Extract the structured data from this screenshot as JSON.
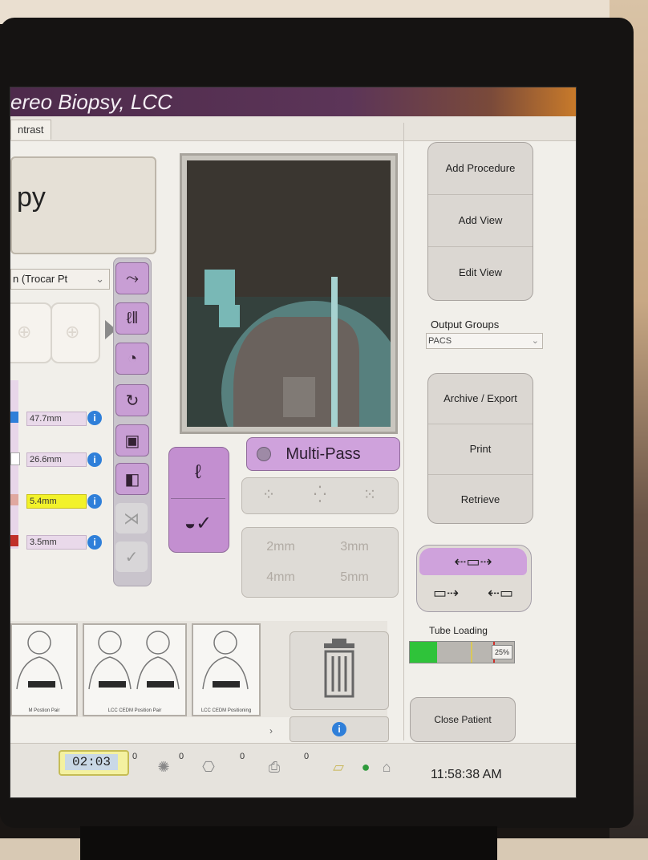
{
  "window": {
    "title": "ereo Biopsy, LCC"
  },
  "tabs": [
    {
      "label": "ntrast"
    }
  ],
  "left": {
    "big_label": "py",
    "needle_select": "n (Trocar Pt",
    "measurements": [
      {
        "value": "47.7mm",
        "highlight": false,
        "bar_color": "#2f7fd9"
      },
      {
        "value": "26.6mm",
        "highlight": false,
        "bar_color": "#ffffff"
      },
      {
        "value": "5.4mm",
        "highlight": true,
        "bar_color": "#e0a8a0"
      },
      {
        "value": "3.5mm",
        "highlight": false,
        "bar_color": "#c0302a"
      }
    ]
  },
  "tools": [
    {
      "name": "needle-path-icon",
      "glyph": "⤳",
      "active": true
    },
    {
      "name": "needle-depth-icon",
      "glyph": "ℓ‖",
      "active": true
    },
    {
      "name": "breast-icon",
      "glyph": "◔",
      "active": true
    },
    {
      "name": "rotate-icon",
      "glyph": "↻",
      "active": true
    },
    {
      "name": "monitor-icon",
      "glyph": "▣",
      "active": true
    },
    {
      "name": "contrast-icon",
      "glyph": "◧",
      "active": true
    },
    {
      "name": "split-icon",
      "glyph": "⋊",
      "active": false
    },
    {
      "name": "check-icon",
      "glyph": "✓",
      "active": false
    }
  ],
  "modes": [
    {
      "name": "mode-outline",
      "glyph": "ℓ"
    },
    {
      "name": "mode-filled-check",
      "glyph": "◒✓"
    }
  ],
  "multipass": {
    "label": "Multi-Pass"
  },
  "patterns": [
    "⁘",
    "⁛",
    "⁙"
  ],
  "sizes": [
    "2mm",
    "3mm",
    "4mm",
    "5mm"
  ],
  "right": {
    "group1": [
      "Add Procedure",
      "Add View",
      "Edit View"
    ],
    "output_groups_label": "Output Groups",
    "output_groups_value": "PACS",
    "group2": [
      "Archive / Export",
      "Print",
      "Retrieve"
    ],
    "tube_loading_label": "Tube Loading",
    "tube_loading_fraction": 0.26,
    "tube_pct": "25%",
    "close_patient": "Close Patient"
  },
  "thumbnails": [
    {
      "caption": "M Postion Pair"
    },
    {
      "caption": "LCC CEDM Position Pair"
    },
    {
      "caption": "LCC CEDM Positioning"
    }
  ],
  "taskbar": {
    "timer": "02:03",
    "counts": [
      "0",
      "0",
      "0",
      "0"
    ],
    "clock": "11:58:38 AM"
  },
  "colors": {
    "accent": "#c89ed4",
    "title_bar": "#4d2a4b",
    "info": "#2f7fd9"
  }
}
